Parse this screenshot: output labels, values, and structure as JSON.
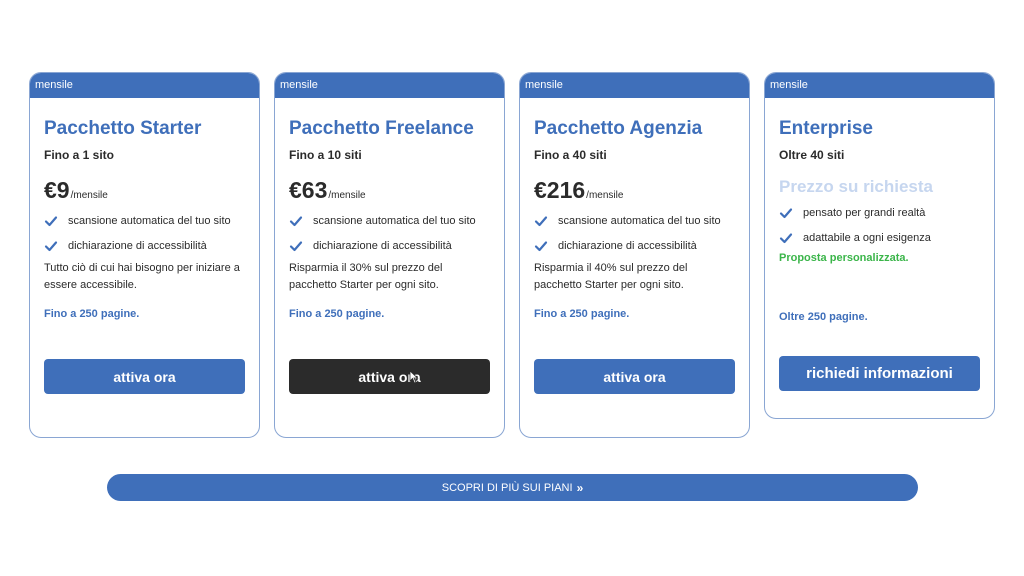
{
  "plans": [
    {
      "badge": "mensile",
      "title": "Pacchetto Starter",
      "subtitle": "Fino a 1 sito",
      "price": "€9",
      "period": "/mensile",
      "features": [
        "scansione automatica del tuo sito",
        "dichiarazione di accessibilità"
      ],
      "description": "Tutto ciò di cui hai bisogno per iniziare a essere accessibile.",
      "limit": "Fino a 250 pagine.",
      "button": "attiva ora"
    },
    {
      "badge": "mensile",
      "title": "Pacchetto Freelance",
      "subtitle": "Fino a 10 siti",
      "price": "€63",
      "period": "/mensile",
      "features": [
        "scansione automatica del tuo sito",
        "dichiarazione di accessibilità"
      ],
      "description": "Risparmia il 30% sul prezzo del pacchetto Starter per ogni sito.",
      "limit": "Fino a 250 pagine.",
      "button": "attiva ora"
    },
    {
      "badge": "mensile",
      "title": "Pacchetto Agenzia",
      "subtitle": "Fino a 40 siti",
      "price": "€216",
      "period": "/mensile",
      "features": [
        "scansione automatica del tuo sito",
        "dichiarazione di accessibilità"
      ],
      "description": "Risparmia il 40% sul prezzo del pacchetto Starter per ogni sito.",
      "limit": "Fino a 250 pagine.",
      "button": "attiva ora"
    },
    {
      "badge": "mensile",
      "title": "Enterprise",
      "subtitle": "Oltre 40 siti",
      "price_request": "Prezzo su richiesta",
      "features": [
        "pensato per grandi realtà",
        "adattabile a ogni esigenza"
      ],
      "highlight": "Proposta personalizzata.",
      "limit": "Oltre 250 pagine.",
      "button": "richiedi informazioni"
    }
  ],
  "more_link": {
    "label": "SCOPRI DI PIÙ SUI PIANI",
    "icon": "double-chevron-right-icon"
  },
  "colors": {
    "primary": "#3f6fba",
    "dark_button": "#2b2b2b",
    "highlight_green": "#3bb54a",
    "muted_price": "#c6d6ef"
  }
}
